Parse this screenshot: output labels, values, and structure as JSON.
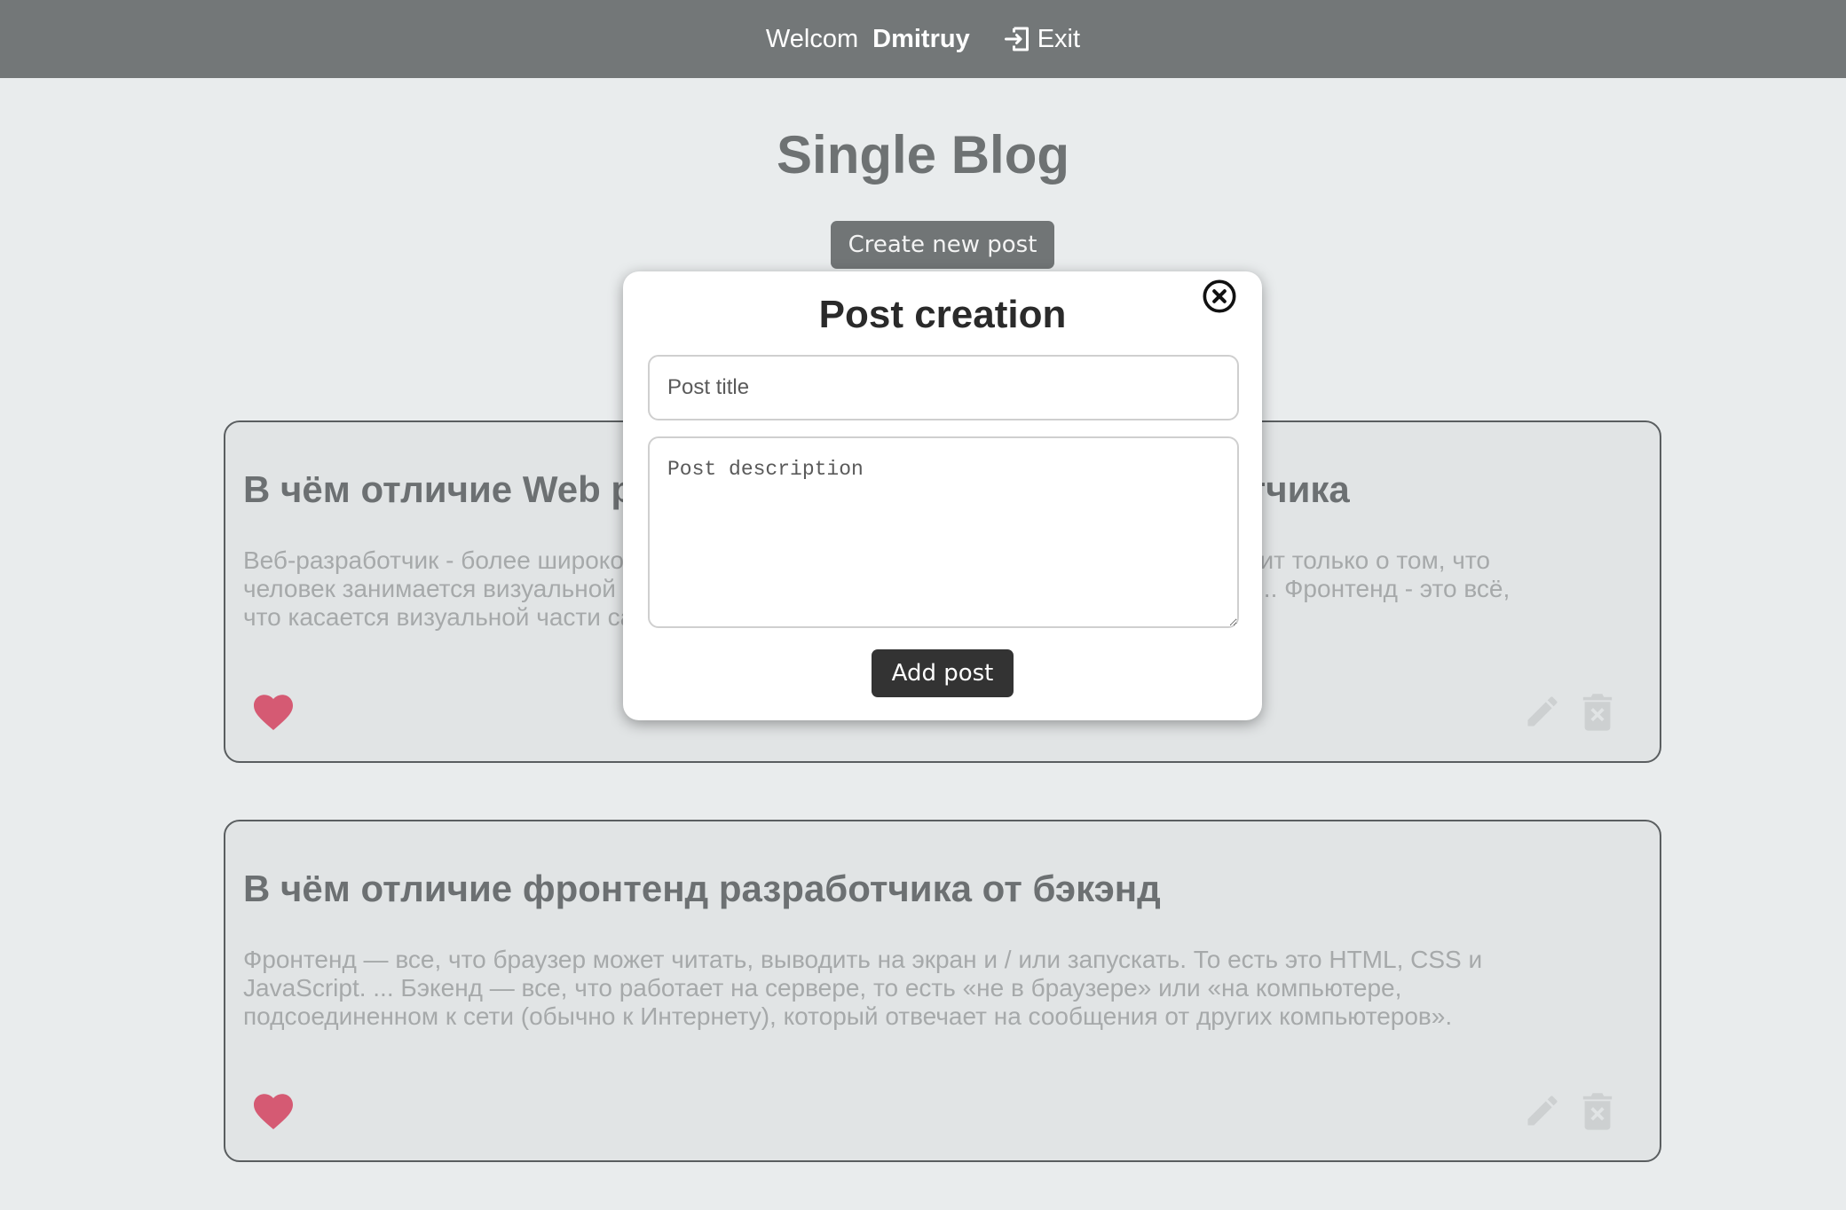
{
  "header": {
    "welcome_text": "Welcom",
    "username": "Dmitruy",
    "exit_label": "Exit"
  },
  "page": {
    "title": "Single Blog",
    "create_button": "Create new post"
  },
  "posts": [
    {
      "title": "В чём отличие Web разработчика от Frontend разработчика",
      "description": "Веб-разработчик - более широкое понятие, а фронтенд разработчик по значению говорит только о том, что человек занимается визуальной частью, то есть той стороной, что видит клиент сайта. ... Фронтенд - это всё, что касается визуальной части сайта, что видит пользователь."
    },
    {
      "title": "В чём отличие фронтенд разработчика от бэкэнд",
      "description": "Фронтенд — все, что браузер может читать, выводить на экран и / или запускать. То есть это HTML, CSS и JavaScript. ... Бэкенд — все, что работает на сервере, то есть «не в браузере» или «на компьютере, подсоединенном к сети (обычно к Интернету), который отвечает на сообщения от других компьютеров»."
    }
  ],
  "modal": {
    "heading": "Post creation",
    "title_placeholder": "Post title",
    "description_placeholder": "Post description",
    "add_button": "Add post"
  },
  "colors": {
    "topbar": "#737778",
    "background": "#e9eced",
    "heart": "#d55a73",
    "action_icons": "#cdd0d1",
    "add_button": "#333333"
  }
}
